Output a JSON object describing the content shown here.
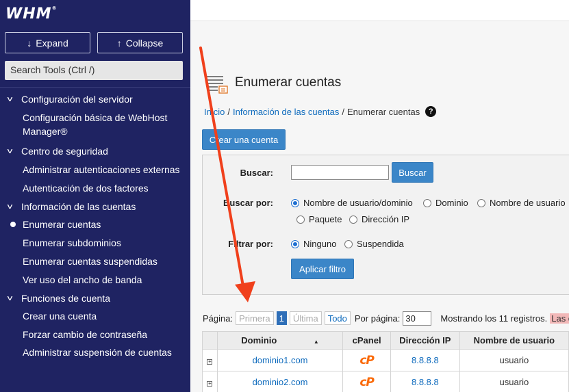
{
  "sidebar": {
    "logo": "WHM",
    "expand_label": "Expand",
    "collapse_label": "Collapse",
    "search_placeholder": "Search Tools (Ctrl /)",
    "nav": {
      "g1": "Configuración del servidor",
      "g1_i1": "Configuración básica de WebHost Manager®",
      "g2": "Centro de seguridad",
      "g2_i1": "Administrar autenticaciones externas",
      "g2_i2": "Autenticación de dos factores",
      "g3": "Información de las cuentas",
      "g3_i1": "Enumerar cuentas",
      "g3_i2": "Enumerar subdominios",
      "g3_i3": "Enumerar cuentas suspendidas",
      "g3_i4": "Ver uso del ancho de banda",
      "g4": "Funciones de cuenta",
      "g4_i1": "Crear una cuenta",
      "g4_i2": "Forzar cambio de contraseña",
      "g4_i3": "Administrar suspensión de cuentas"
    }
  },
  "header": {
    "title": "Enumerar cuentas",
    "breadcrumb": {
      "home": "Inicio",
      "sep": "/",
      "section": "Información de las cuentas",
      "current": "Enumerar cuentas"
    },
    "help_icon": "?"
  },
  "actions": {
    "create_account": "Crear una cuenta"
  },
  "filters": {
    "search_label": "Buscar:",
    "search_value": "",
    "search_button": "Buscar",
    "search_by_label": "Buscar por:",
    "search_by_options": [
      "Nombre de usuario/dominio",
      "Dominio",
      "Nombre de usuario",
      "Paquete",
      "Dirección IP"
    ],
    "search_by_selected": "Nombre de usuario/dominio",
    "filter_by_label": "Filtrar por:",
    "filter_by_options": [
      "Ninguno",
      "Suspendida"
    ],
    "filter_by_selected": "Ninguno",
    "apply_button": "Aplicar filtro"
  },
  "pagination": {
    "page_label": "Página:",
    "first": "Primera",
    "current_page": "1",
    "last": "Última",
    "all": "Todo",
    "per_page_label": "Por página:",
    "per_page_value": "30",
    "showing": "Mostrando los 11 registros.",
    "warning": "Las cue"
  },
  "table": {
    "columns": [
      "Dominio",
      "cPanel",
      "Dirección IP",
      "Nombre de usuario"
    ],
    "rows": [
      {
        "expand": "+",
        "domain": "dominio1.com",
        "cpanel": "cP",
        "ip": "8.8.8.8",
        "user": "usuario"
      },
      {
        "expand": "+",
        "domain": "dominio2.com",
        "cpanel": "cP",
        "ip": "8.8.8.8",
        "user": "usuario"
      }
    ]
  },
  "colors": {
    "sidebar_bg": "#1f2362",
    "primary_button": "#3b86c8",
    "link": "#0f6bbd",
    "annotation_arrow": "#f0401c",
    "cpanel_orange": "#fa6a0a"
  }
}
